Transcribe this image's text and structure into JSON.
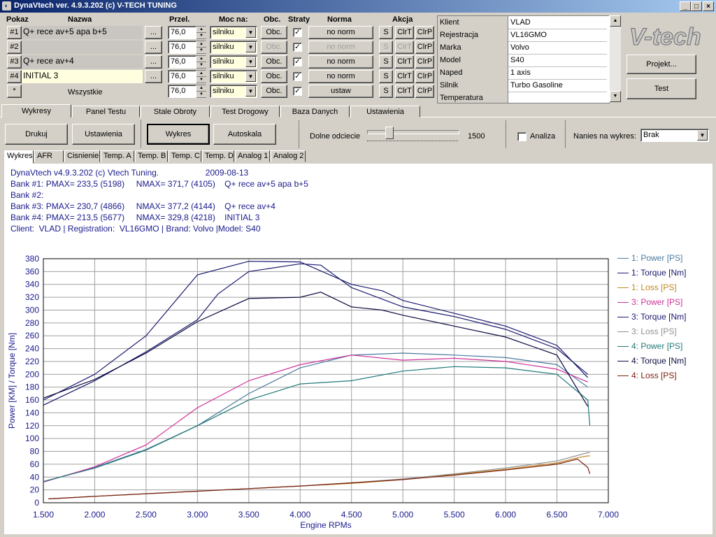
{
  "window": {
    "title": "DynaVtech ver. 4.9.3.202 (c) V-TECH TUNING",
    "min": "_",
    "max": "□",
    "close": "×"
  },
  "headers": {
    "pokaz": "Pokaz",
    "nazwa": "Nazwa",
    "przel": "Przel.",
    "moc_na": "Moc na:",
    "obc": "Obc.",
    "straty": "Straty",
    "norma": "Norma",
    "akcja": "Akcja"
  },
  "banks": [
    {
      "btn": "#1",
      "name": "Q+ rece av+5 apa b+5",
      "dots": "...",
      "przel": "76,0",
      "moc": "silniku",
      "obc": "Obc.",
      "straty": true,
      "norma": "no norm",
      "s": "S",
      "clrt": "ClrT",
      "clrp": "ClrP"
    },
    {
      "btn": "#2",
      "name": "",
      "dots": "...",
      "przel": "76,0",
      "moc": "silniku",
      "obc": "Obc.",
      "straty": true,
      "norma": "no norm",
      "s": "S",
      "clrt": "ClrT",
      "clrp": "ClrP"
    },
    {
      "btn": "#3",
      "name": "Q+ rece av+4",
      "dots": "...",
      "przel": "76,0",
      "moc": "silniku",
      "obc": "Obc.",
      "straty": true,
      "norma": "no norm",
      "s": "S",
      "clrt": "ClrT",
      "clrp": "ClrP"
    },
    {
      "btn": "#4",
      "name": "INITIAL 3",
      "dots": "...",
      "przel": "76,0",
      "moc": "silniku",
      "obc": "Obc.",
      "straty": true,
      "norma": "no norm",
      "s": "S",
      "clrt": "ClrT",
      "clrp": "ClrP"
    },
    {
      "btn": "*",
      "name": "Wszystkie",
      "przel": "76,0",
      "moc": "silniku",
      "obc": "Obc.",
      "straty": true,
      "norma": "ustaw",
      "s": "S",
      "clrt": "ClrT",
      "clrp": "ClrP"
    }
  ],
  "info": [
    {
      "k": "Klient",
      "v": "VLAD"
    },
    {
      "k": "Rejestracja",
      "v": "VL16GMO"
    },
    {
      "k": "Marka",
      "v": "Volvo"
    },
    {
      "k": "Model",
      "v": "S40"
    },
    {
      "k": "Naped",
      "v": "1 axis"
    },
    {
      "k": "Silnik",
      "v": "Turbo Gasoline"
    },
    {
      "k": "Temperatura",
      "v": ""
    }
  ],
  "logo": "V-tech",
  "buttons": {
    "projekt": "Projekt...",
    "test": "Test"
  },
  "tabs": [
    "Wykresy",
    "Panel Testu",
    "Stale Obroty",
    "Test Drogowy",
    "Baza Danych",
    "Ustawienia"
  ],
  "toolbar": {
    "drukuj": "Drukuj",
    "ustawienia": "Ustawienia",
    "wykres": "Wykres",
    "autoskala": "Autoskala",
    "dolne_label": "Dolne odciecie",
    "dolne_value": "1500",
    "slider_fraction": 0.22,
    "analiza": "Analiza",
    "nanies_label": "Nanies na wykres:",
    "nanies_value": "Brak"
  },
  "subtabs": [
    "Wykres",
    "AFR",
    "Cisnienie",
    "Temp. A",
    "Temp. B",
    "Temp. C",
    "Temp. D",
    "Analog 1",
    "Analog 2"
  ],
  "infolines": [
    "DynaVtech v4.9.3.202 (c) Vtech Tuning.                    2009-08-13",
    "Bank #1: PMAX= 233,5 (5198)     NMAX= 371,7 (4105)    Q+ rece av+5 apa b+5",
    "Bank #2:",
    "Bank #3: PMAX= 230,7 (4866)     NMAX= 377,2 (4144)    Q+ rece av+4",
    "Bank #4: PMAX= 213,5 (5677)     NMAX= 329,8 (4218)    INITIAL 3",
    "Client:  VLAD | Registration:  VL16GMO | Brand: Volvo |Model: S40"
  ],
  "chart_data": {
    "type": "line",
    "xlabel": "Engine RPMs",
    "ylabel": "Power [KM] / Torque [Nm]",
    "xlim": [
      1500,
      7000
    ],
    "ylim": [
      0,
      380
    ],
    "xticks": [
      "1.500",
      "2.000",
      "2.500",
      "3.000",
      "3.500",
      "4.000",
      "4.500",
      "5.000",
      "5.500",
      "6.000",
      "6.500",
      "7.000"
    ],
    "yticks": [
      "0",
      "20",
      "40",
      "60",
      "80",
      "100",
      "120",
      "140",
      "160",
      "180",
      "200",
      "220",
      "240",
      "260",
      "280",
      "300",
      "320",
      "340",
      "360",
      "380"
    ],
    "grid": true,
    "legend_position": "right",
    "series": [
      {
        "name": "1: Power [PS]",
        "color": "#4a7aa0",
        "x": [
          1500,
          2000,
          2500,
          3000,
          3500,
          4000,
          4500,
          5000,
          5500,
          6000,
          6500,
          6800
        ],
        "y": [
          33,
          55,
          83,
          120,
          170,
          210,
          230,
          233,
          230,
          226,
          215,
          180
        ]
      },
      {
        "name": "1: Torque [Nm]",
        "color": "#18186e",
        "x": [
          1500,
          2000,
          2500,
          3000,
          3200,
          3500,
          4000,
          4200,
          4500,
          5000,
          5500,
          6000,
          6500,
          6800
        ],
        "y": [
          152,
          190,
          235,
          285,
          325,
          360,
          372,
          370,
          335,
          305,
          290,
          270,
          240,
          200
        ]
      },
      {
        "name": "1: Loss [PS]",
        "color": "#c08820",
        "x": [
          1550,
          2000,
          2500,
          3000,
          3500,
          4000,
          4500,
          5000,
          5500,
          6000,
          6500,
          6700,
          6800,
          6820
        ],
        "y": [
          6,
          10,
          14,
          18,
          22,
          26,
          30,
          36,
          44,
          52,
          62,
          70,
          73,
          73
        ]
      },
      {
        "name": "3: Power [PS]",
        "color": "#d0309a",
        "x": [
          1500,
          2000,
          2500,
          3000,
          3500,
          4000,
          4500,
          5000,
          5500,
          6000,
          6500,
          6800
        ],
        "y": [
          32,
          56,
          90,
          148,
          190,
          215,
          230,
          222,
          225,
          220,
          208,
          188
        ]
      },
      {
        "name": "3: Torque [Nm]",
        "color": "#18186e",
        "x": [
          1500,
          2000,
          2500,
          3000,
          3500,
          4000,
          4500,
          4800,
          5000,
          5500,
          6000,
          6500,
          6800
        ],
        "y": [
          160,
          200,
          260,
          355,
          376,
          375,
          340,
          330,
          315,
          295,
          275,
          245,
          195
        ]
      },
      {
        "name": "3: Loss [PS]",
        "color": "#909090",
        "x": [
          1550,
          2000,
          2500,
          3000,
          3500,
          4000,
          4500,
          5000,
          5500,
          6000,
          6500,
          6800,
          6820
        ],
        "y": [
          6,
          10,
          14,
          18,
          22,
          26,
          31,
          37,
          45,
          54,
          65,
          78,
          78
        ]
      },
      {
        "name": "4: Power [PS]",
        "color": "#207878",
        "x": [
          1500,
          2000,
          2500,
          3000,
          3500,
          4000,
          4500,
          5000,
          5500,
          6000,
          6500,
          6800,
          6820
        ],
        "y": [
          33,
          54,
          82,
          120,
          160,
          185,
          190,
          205,
          212,
          210,
          200,
          160,
          120
        ]
      },
      {
        "name": "4: Torque [Nm]",
        "color": "#0a0a40",
        "x": [
          1500,
          2000,
          2500,
          3000,
          3500,
          4000,
          4200,
          4500,
          4800,
          5000,
          5500,
          6000,
          6500,
          6800
        ],
        "y": [
          163,
          192,
          233,
          282,
          318,
          320,
          328,
          305,
          300,
          292,
          275,
          258,
          230,
          150
        ]
      },
      {
        "name": "4: Loss [PS]",
        "color": "#7a2010",
        "x": [
          1550,
          2000,
          2500,
          3000,
          3500,
          4000,
          4500,
          5000,
          5500,
          6000,
          6500,
          6700,
          6800,
          6820
        ],
        "y": [
          6,
          10,
          14,
          18,
          22,
          26,
          31,
          36,
          43,
          51,
          60,
          68,
          55,
          45
        ]
      }
    ]
  }
}
